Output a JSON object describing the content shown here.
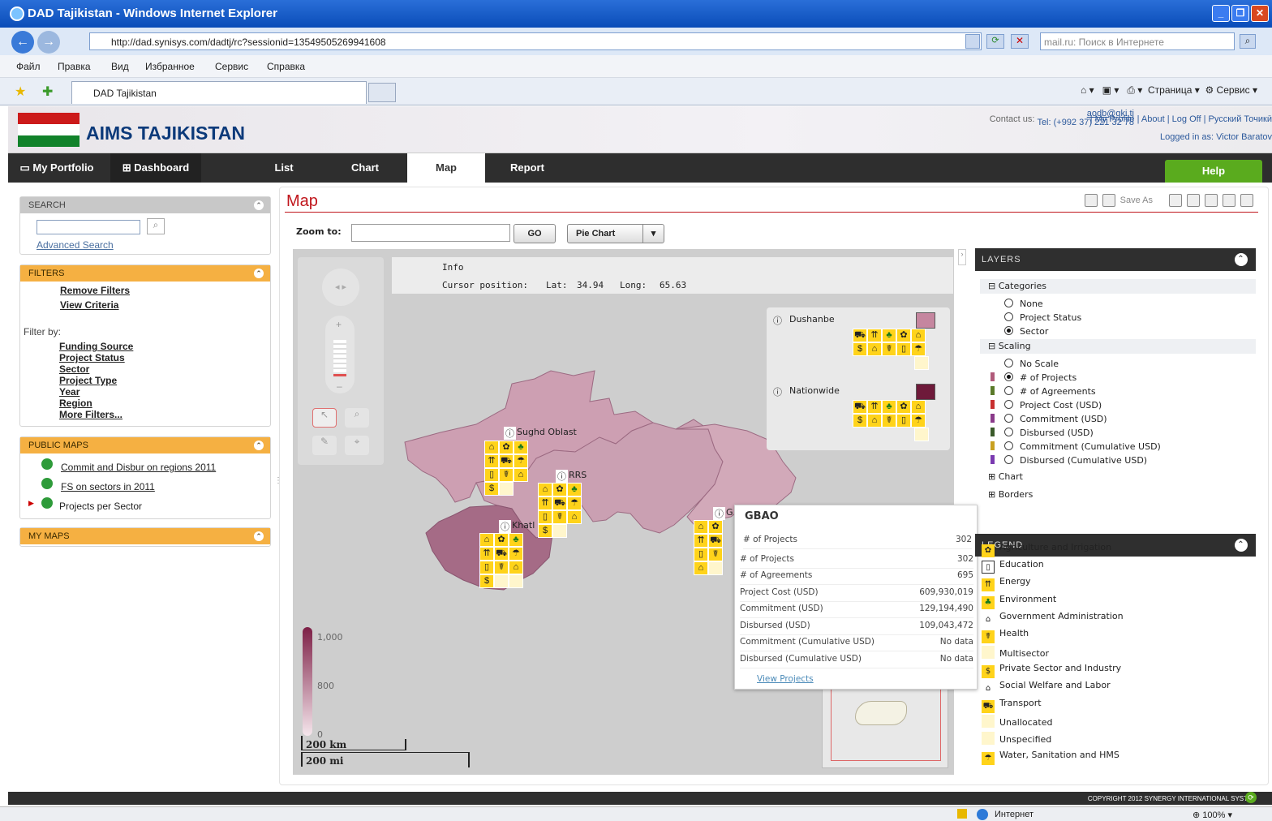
{
  "window": {
    "title": "DAD Tajikistan - Windows Internet Explorer"
  },
  "browser": {
    "url": "http://dad.synisys.com/dadtj/rc?sessionid=13549505269941608",
    "search_placeholder": "mail.ru: Поиск в Интернете",
    "menu": [
      "Файл",
      "Правка",
      "Вид",
      "Избранное",
      "Сервис",
      "Справка"
    ],
    "tab_title": "DAD Tajikistan",
    "commands": {
      "page": "Страница",
      "tools": "Сервис"
    }
  },
  "app": {
    "brand": "AIMS TAJIKISTAN",
    "contact_label": "Contact us:",
    "contact_email": "aodb@gki.tj",
    "contact_tel": "Tel: (+992 37) 221 32 78",
    "links": [
      "My Profile",
      "About",
      "Log Off",
      "Русский",
      "Точикӣ"
    ],
    "logged_in": "Logged in as: Victor Baratov"
  },
  "nav": {
    "portfolio": "My Portfolio",
    "dashboard": "Dashboard",
    "tabs": [
      "List",
      "Chart",
      "Map",
      "Report"
    ],
    "help": "Help"
  },
  "sidebar": {
    "search_title": "SEARCH",
    "advanced": "Advanced Search",
    "filters_title": "FILTERS",
    "remove": "Remove Filters",
    "view": "View Criteria",
    "filter_by": "Filter by:",
    "filter_items": [
      "Funding Source",
      "Project Status",
      "Sector",
      "Project Type",
      "Year",
      "Region",
      "More Filters..."
    ],
    "public_title": "PUBLIC MAPS",
    "public_items": [
      "Commit and Disbur on regions 2011",
      "FS on sectors in 2011",
      "Projects per Sector"
    ],
    "mymaps_title": "MY MAPS"
  },
  "main": {
    "title": "Map",
    "save_as": "Save As",
    "zoom_label": "Zoom to:",
    "go": "GO",
    "pie": "Pie Chart"
  },
  "map": {
    "info": "Info",
    "cursor_label": "Cursor position:",
    "lat_label": "Lat:",
    "lat": "34.94",
    "long_label": "Long:",
    "long": "65.63",
    "regions": [
      "Sughd Oblast",
      "RRS",
      "Khatl",
      "G"
    ],
    "box_labels": [
      "Dushanbe",
      "Nationwide"
    ],
    "scale": {
      "max": "1,000",
      "mid": "800",
      "min": "0"
    },
    "scale_km": "200 km",
    "scale_mi": "200 mi"
  },
  "popup": {
    "title": "GBAO",
    "rows": [
      {
        "k": "# of Projects",
        "v": "302"
      },
      {
        "k": "# of Projects",
        "v": "302"
      },
      {
        "k": "# of Agreements",
        "v": "695"
      },
      {
        "k": "Project Cost (USD)",
        "v": "609,930,019"
      },
      {
        "k": "Commitment (USD)",
        "v": "129,194,490"
      },
      {
        "k": "Disbursed (USD)",
        "v": "109,043,472"
      },
      {
        "k": "Commitment (Cumulative USD)",
        "v": "No data"
      },
      {
        "k": "Disbursed (Cumulative USD)",
        "v": "No data"
      }
    ],
    "link": "View Projects"
  },
  "layers": {
    "title": "LAYERS",
    "categories": "Categories",
    "cat_options": [
      "None",
      "Project Status",
      "Sector"
    ],
    "scaling": "Scaling",
    "scale_options": [
      "No Scale",
      "# of Projects",
      "# of Agreements",
      "Project Cost (USD)",
      "Commitment (USD)",
      "Disbursed (USD)",
      "Commitment (Cumulative USD)",
      "Disbursed (Cumulative USD)"
    ],
    "chart": "Chart",
    "borders": "Borders"
  },
  "legend": {
    "title": "LEGEND",
    "items": [
      "Agriculture and Irrigation",
      "Education",
      "Energy",
      "Environment",
      "Government Administration",
      "Health",
      "Multisector",
      "Private Sector and Industry",
      "Social Welfare and Labor",
      "Transport",
      "Unallocated",
      "Unspecified",
      "Water, Sanitation and HMS"
    ]
  },
  "footer": {
    "copyright": "COPYRIGHT 2012 SYNERGY INTERNATIONAL SYST"
  },
  "status": {
    "zone": "Интернет",
    "zoom": "100%"
  },
  "colors": {
    "accent": "#c0161c",
    "orange": "#f5b042",
    "map_region": "#cc9fb1",
    "map_dark": "#a86a85",
    "help": "#5aab1e"
  }
}
